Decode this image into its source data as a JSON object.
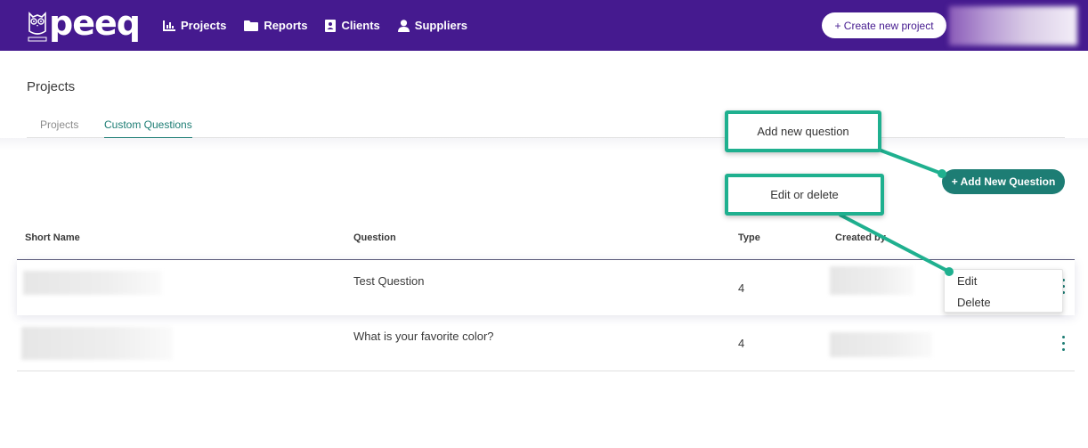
{
  "brand": {
    "name": "peeq"
  },
  "nav": {
    "items": [
      {
        "label": "Projects",
        "icon": "bar-chart-icon"
      },
      {
        "label": "Reports",
        "icon": "folder-icon"
      },
      {
        "label": "Clients",
        "icon": "contact-card-icon"
      },
      {
        "label": "Suppliers",
        "icon": "user-icon"
      }
    ],
    "create_label": "+ Create new project"
  },
  "page": {
    "title": "Projects",
    "tabs": [
      {
        "label": "Projects",
        "active": false
      },
      {
        "label": "Custom Questions",
        "active": true
      }
    ],
    "add_button_label": "+ Add New Question"
  },
  "table": {
    "headers": [
      "Short Name",
      "Question",
      "Type",
      "Created by"
    ],
    "rows": [
      {
        "question": "Test Question",
        "type": "4"
      },
      {
        "question": "What is your favorite color?",
        "type": "4"
      }
    ]
  },
  "row_menu": {
    "items": [
      "Edit",
      "Delete"
    ]
  },
  "callouts": {
    "add": "Add new question",
    "edit": "Edit or delete"
  },
  "colors": {
    "header_bg": "#451a8f",
    "accent": "#1d7d74",
    "callout_border": "#1fb08f"
  }
}
